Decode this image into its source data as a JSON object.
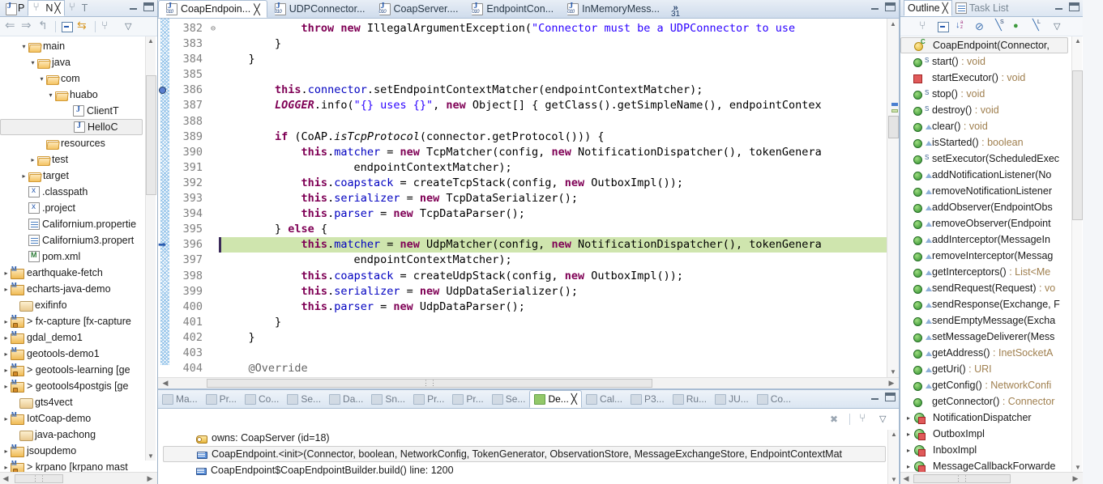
{
  "left_panel": {
    "tabs": [
      {
        "label": "P",
        "icon": "package-explorer-icon",
        "active": false
      },
      {
        "label": "N",
        "icon": "navigator-icon",
        "active": true
      },
      {
        "label": "T",
        "icon": "type-hierarchy-icon",
        "active": false
      }
    ],
    "toolbar": [
      "back-icon",
      "forward-icon",
      "up-icon",
      "collapse-all-icon",
      "link-with-editor-icon",
      "view-layout-icon",
      "view-menu-icon"
    ],
    "tree": [
      {
        "label": "main",
        "icon": "folder-icon",
        "indent": 2,
        "arrow": "open"
      },
      {
        "label": "java",
        "icon": "folder-icon",
        "indent": 3,
        "arrow": "open"
      },
      {
        "label": "com",
        "icon": "folder-icon",
        "indent": 4,
        "arrow": "open"
      },
      {
        "label": "huabo",
        "icon": "folder-icon",
        "indent": 5,
        "arrow": "open"
      },
      {
        "label": "ClientT",
        "icon": "java-file-icon",
        "indent": 7,
        "arrow": "none"
      },
      {
        "label": "HelloC",
        "icon": "java-file-icon",
        "indent": 7,
        "arrow": "none",
        "selected": true
      },
      {
        "label": "resources",
        "icon": "folder-icon",
        "indent": 4,
        "arrow": "none"
      },
      {
        "label": "test",
        "icon": "folder-icon",
        "indent": 3,
        "arrow": "closed"
      },
      {
        "label": "target",
        "icon": "folder-icon",
        "indent": 2,
        "arrow": "closed"
      },
      {
        "label": ".classpath",
        "icon": "x-file-icon",
        "indent": 2,
        "arrow": "none"
      },
      {
        "label": ".project",
        "icon": "x-file-icon",
        "indent": 2,
        "arrow": "none"
      },
      {
        "label": "Californium.propertie",
        "icon": "doc-file-icon",
        "indent": 2,
        "arrow": "none"
      },
      {
        "label": "Californium3.propert",
        "icon": "doc-file-icon",
        "indent": 2,
        "arrow": "none"
      },
      {
        "label": "pom.xml",
        "icon": "maven-file-icon",
        "indent": 2,
        "arrow": "none"
      },
      {
        "label": "earthquake-fetch",
        "icon": "maven-project-icon",
        "indent": 0,
        "arrow": "closed"
      },
      {
        "label": "echarts-java-demo",
        "icon": "maven-project-icon",
        "indent": 0,
        "arrow": "closed"
      },
      {
        "label": "exifinfo",
        "icon": "project-icon",
        "indent": 1,
        "arrow": "none"
      },
      {
        "label": "> fx-capture [fx-capture",
        "icon": "maven-project-locked-icon",
        "indent": 0,
        "arrow": "closed"
      },
      {
        "label": "gdal_demo1",
        "icon": "maven-project-icon",
        "indent": 0,
        "arrow": "closed"
      },
      {
        "label": "geotools-demo1",
        "icon": "maven-project-icon",
        "indent": 0,
        "arrow": "closed"
      },
      {
        "label": "> geotools-learning [ge",
        "icon": "maven-project-locked-icon",
        "indent": 0,
        "arrow": "closed"
      },
      {
        "label": "> geotools4postgis [ge",
        "icon": "maven-project-locked-icon",
        "indent": 0,
        "arrow": "closed"
      },
      {
        "label": "gts4vect",
        "icon": "project-icon",
        "indent": 1,
        "arrow": "none"
      },
      {
        "label": "IotCoap-demo",
        "icon": "maven-project-icon",
        "indent": 0,
        "arrow": "closed"
      },
      {
        "label": "java-pachong",
        "icon": "project-icon",
        "indent": 1,
        "arrow": "none"
      },
      {
        "label": "jsoupdemo",
        "icon": "maven-project-icon",
        "indent": 0,
        "arrow": "closed"
      },
      {
        "label": "> krpano [krpano mast",
        "icon": "maven-project-locked-icon",
        "indent": 0,
        "arrow": "closed"
      }
    ]
  },
  "editor": {
    "tabs": [
      {
        "label": "CoapEndpoin...",
        "active": true,
        "closable": true
      },
      {
        "label": "UDPConnector...",
        "active": false
      },
      {
        "label": "CoapServer....",
        "active": false
      },
      {
        "label": "EndpointCon...",
        "active": false
      },
      {
        "label": "InMemoryMess...",
        "active": false
      }
    ],
    "overflow_count": "31",
    "overflow_symbol": "»",
    "first_line": 382,
    "current_line": 396,
    "lines": [
      {
        "n": 382,
        "indent": 12,
        "parts": [
          {
            "t": "throw ",
            "c": "kw"
          },
          {
            "t": "new ",
            "c": "kw"
          },
          {
            "t": "IllegalArgumentException(",
            "c": ""
          },
          {
            "t": "\"Connector must be a UDPConnector to use",
            "c": "str"
          }
        ]
      },
      {
        "n": 383,
        "indent": 8,
        "parts": [
          {
            "t": "}",
            "c": ""
          }
        ]
      },
      {
        "n": 384,
        "indent": 4,
        "parts": [
          {
            "t": "}",
            "c": ""
          }
        ]
      },
      {
        "n": 385,
        "indent": 0,
        "parts": []
      },
      {
        "n": 386,
        "indent": 8,
        "parts": [
          {
            "t": "this",
            "c": "kw"
          },
          {
            "t": ".",
            "c": ""
          },
          {
            "t": "connector",
            "c": "fld"
          },
          {
            "t": ".setEndpointContextMatcher(endpointContextMatcher);",
            "c": ""
          }
        ]
      },
      {
        "n": 387,
        "indent": 8,
        "parts": [
          {
            "t": "LOGGER",
            "c": "stat"
          },
          {
            "t": ".info(",
            "c": ""
          },
          {
            "t": "\"{} uses {}\"",
            "c": "str"
          },
          {
            "t": ", ",
            "c": ""
          },
          {
            "t": "new ",
            "c": "kw"
          },
          {
            "t": "Object[] { getClass().getSimpleName(), endpointContex",
            "c": ""
          }
        ]
      },
      {
        "n": 388,
        "indent": 0,
        "parts": []
      },
      {
        "n": 389,
        "indent": 8,
        "parts": [
          {
            "t": "if ",
            "c": "kw"
          },
          {
            "t": "(CoAP.",
            "c": ""
          },
          {
            "t": "isTcpProtocol",
            "c": "statm"
          },
          {
            "t": "(connector.getProtocol())) {",
            "c": ""
          }
        ]
      },
      {
        "n": 390,
        "indent": 12,
        "parts": [
          {
            "t": "this",
            "c": "kw"
          },
          {
            "t": ".",
            "c": ""
          },
          {
            "t": "matcher",
            "c": "fld"
          },
          {
            "t": " = ",
            "c": ""
          },
          {
            "t": "new ",
            "c": "kw"
          },
          {
            "t": "TcpMatcher(config, ",
            "c": ""
          },
          {
            "t": "new ",
            "c": "kw"
          },
          {
            "t": "NotificationDispatcher(), tokenGenera",
            "c": ""
          }
        ]
      },
      {
        "n": 391,
        "indent": 20,
        "parts": [
          {
            "t": "endpointContextMatcher);",
            "c": ""
          }
        ]
      },
      {
        "n": 392,
        "indent": 12,
        "parts": [
          {
            "t": "this",
            "c": "kw"
          },
          {
            "t": ".",
            "c": ""
          },
          {
            "t": "coapstack",
            "c": "fld"
          },
          {
            "t": " = createTcpStack(config, ",
            "c": ""
          },
          {
            "t": "new ",
            "c": "kw"
          },
          {
            "t": "OutboxImpl());",
            "c": ""
          }
        ]
      },
      {
        "n": 393,
        "indent": 12,
        "parts": [
          {
            "t": "this",
            "c": "kw"
          },
          {
            "t": ".",
            "c": ""
          },
          {
            "t": "serializer",
            "c": "fld"
          },
          {
            "t": " = ",
            "c": ""
          },
          {
            "t": "new ",
            "c": "kw"
          },
          {
            "t": "TcpDataSerializer();",
            "c": ""
          }
        ]
      },
      {
        "n": 394,
        "indent": 12,
        "parts": [
          {
            "t": "this",
            "c": "kw"
          },
          {
            "t": ".",
            "c": ""
          },
          {
            "t": "parser",
            "c": "fld"
          },
          {
            "t": " = ",
            "c": ""
          },
          {
            "t": "new ",
            "c": "kw"
          },
          {
            "t": "TcpDataParser();",
            "c": ""
          }
        ]
      },
      {
        "n": 395,
        "indent": 8,
        "parts": [
          {
            "t": "} ",
            "c": ""
          },
          {
            "t": "else ",
            "c": "kw"
          },
          {
            "t": "{",
            "c": ""
          }
        ]
      },
      {
        "n": 396,
        "indent": 12,
        "highlight": true,
        "parts": [
          {
            "t": "this",
            "c": "kw"
          },
          {
            "t": ".",
            "c": ""
          },
          {
            "t": "matcher",
            "c": "fld"
          },
          {
            "t": " = ",
            "c": ""
          },
          {
            "t": "new ",
            "c": "kw"
          },
          {
            "t": "UdpMatcher(config, ",
            "c": ""
          },
          {
            "t": "new ",
            "c": "kw"
          },
          {
            "t": "NotificationDispatcher(), tokenGenera",
            "c": ""
          }
        ]
      },
      {
        "n": 397,
        "indent": 20,
        "parts": [
          {
            "t": "endpointContextMatcher);",
            "c": ""
          }
        ]
      },
      {
        "n": 398,
        "indent": 12,
        "parts": [
          {
            "t": "this",
            "c": "kw"
          },
          {
            "t": ".",
            "c": ""
          },
          {
            "t": "coapstack",
            "c": "fld"
          },
          {
            "t": " = createUdpStack(config, ",
            "c": ""
          },
          {
            "t": "new ",
            "c": "kw"
          },
          {
            "t": "OutboxImpl());",
            "c": ""
          }
        ]
      },
      {
        "n": 399,
        "indent": 12,
        "parts": [
          {
            "t": "this",
            "c": "kw"
          },
          {
            "t": ".",
            "c": ""
          },
          {
            "t": "serializer",
            "c": "fld"
          },
          {
            "t": " = ",
            "c": ""
          },
          {
            "t": "new ",
            "c": "kw"
          },
          {
            "t": "UdpDataSerializer();",
            "c": ""
          }
        ]
      },
      {
        "n": 400,
        "indent": 12,
        "parts": [
          {
            "t": "this",
            "c": "kw"
          },
          {
            "t": ".",
            "c": ""
          },
          {
            "t": "parser",
            "c": "fld"
          },
          {
            "t": " = ",
            "c": ""
          },
          {
            "t": "new ",
            "c": "kw"
          },
          {
            "t": "UdpDataParser();",
            "c": ""
          }
        ]
      },
      {
        "n": 401,
        "indent": 8,
        "parts": [
          {
            "t": "}",
            "c": ""
          }
        ]
      },
      {
        "n": 402,
        "indent": 4,
        "parts": [
          {
            "t": "}",
            "c": ""
          }
        ]
      },
      {
        "n": 403,
        "indent": 0,
        "parts": []
      },
      {
        "n": 404,
        "indent": 4,
        "fold": true,
        "parts": [
          {
            "t": "@Override",
            "c": "anno"
          }
        ]
      }
    ]
  },
  "bottom_panel": {
    "tabs": [
      {
        "label": "Ma...",
        "icon": "markers-icon",
        "active": false
      },
      {
        "label": "Pr...",
        "icon": "properties-icon",
        "active": false
      },
      {
        "label": "Co...",
        "icon": "console-icon",
        "active": false
      },
      {
        "label": "Se...",
        "icon": "servers-icon",
        "active": false
      },
      {
        "label": "Da...",
        "icon": "data-source-icon",
        "active": false
      },
      {
        "label": "Sn...",
        "icon": "snippets-icon",
        "active": false
      },
      {
        "label": "Pr...",
        "icon": "problems-icon",
        "active": false
      },
      {
        "label": "Pr...",
        "icon": "progress-icon",
        "active": false
      },
      {
        "label": "Se...",
        "icon": "search-icon",
        "active": false
      },
      {
        "label": "De...",
        "icon": "debug-icon",
        "active": true,
        "closable": true
      },
      {
        "label": "Cal...",
        "icon": "call-hierarchy-icon",
        "active": false
      },
      {
        "label": "P3...",
        "icon": "terminal-icon",
        "active": false
      },
      {
        "label": "Ru...",
        "icon": "terminal-icon",
        "active": false
      },
      {
        "label": "JU...",
        "icon": "junit-icon",
        "active": false
      },
      {
        "label": "Co...",
        "icon": "coverage-icon",
        "active": false
      }
    ],
    "toolbar": [
      "disconnect-icon",
      "thread-view-icon",
      "view-menu-icon"
    ],
    "stack": [
      {
        "label": "owns: CoapServer  (id=18)",
        "icon": "monitor-icon",
        "selected": false
      },
      {
        "label": "CoapEndpoint.<init>(Connector, boolean, NetworkConfig, TokenGenerator, ObservationStore, MessageExchangeStore, EndpointContextMat",
        "icon": "stack-frame-icon",
        "selected": true
      },
      {
        "label": "CoapEndpoint$CoapEndpointBuilder.build() line: 1200",
        "icon": "stack-frame-icon",
        "selected": false
      }
    ]
  },
  "right_panel": {
    "tabs": [
      {
        "label": "Outline",
        "active": true,
        "closable": true
      },
      {
        "label": "Task List",
        "active": false,
        "icon": "task-list-icon"
      }
    ],
    "toolbar": [
      "collapse-all-icon",
      "hide-fields-icon",
      "sort-icon",
      "hide-static-icon",
      "hide-nonpublic-icon",
      "hide-local-icon",
      "filter-icon",
      "view-menu-icon"
    ],
    "items": [
      {
        "label": "CoapEndpoint(Connector,",
        "icon": "constructor-icon",
        "mod": "",
        "selected": true
      },
      {
        "label": "start() : void",
        "icon": "method-public-icon",
        "mod": "static-sync",
        "type": ""
      },
      {
        "label": "startExecutor() : void",
        "icon": "method-private-icon",
        "mod": "",
        "type": ""
      },
      {
        "label": "stop() : void",
        "icon": "method-public-icon",
        "mod": "static-sync",
        "type": ""
      },
      {
        "label": "destroy() : void",
        "icon": "method-public-icon",
        "mod": "static-sync",
        "type": ""
      },
      {
        "label": "clear() : void",
        "icon": "method-public-icon",
        "mod": "tri",
        "type": ""
      },
      {
        "label": "isStarted() : boolean",
        "icon": "method-public-icon",
        "mod": "tri",
        "type": ""
      },
      {
        "label": "setExecutor(ScheduledExec",
        "icon": "method-public-icon",
        "mod": "static-sync",
        "type": ""
      },
      {
        "label": "addNotificationListener(No",
        "icon": "method-public-icon",
        "mod": "tri",
        "type": ""
      },
      {
        "label": "removeNotificationListener",
        "icon": "method-public-icon",
        "mod": "tri",
        "type": ""
      },
      {
        "label": "addObserver(EndpointObs",
        "icon": "method-public-icon",
        "mod": "tri",
        "type": ""
      },
      {
        "label": "removeObserver(Endpoint",
        "icon": "method-public-icon",
        "mod": "tri",
        "type": ""
      },
      {
        "label": "addInterceptor(MessageIn",
        "icon": "method-public-icon",
        "mod": "tri",
        "type": ""
      },
      {
        "label": "removeInterceptor(Messag",
        "icon": "method-public-icon",
        "mod": "tri",
        "type": ""
      },
      {
        "label": "getInterceptors() : List<Me",
        "icon": "method-public-icon",
        "mod": "tri",
        "type": ""
      },
      {
        "label": "sendRequest(Request) : vo",
        "icon": "method-public-icon",
        "mod": "tri",
        "type": ""
      },
      {
        "label": "sendResponse(Exchange, F",
        "icon": "method-public-icon",
        "mod": "tri",
        "type": ""
      },
      {
        "label": "sendEmptyMessage(Excha",
        "icon": "method-public-icon",
        "mod": "tri",
        "type": ""
      },
      {
        "label": "setMessageDeliverer(Mess",
        "icon": "method-public-icon",
        "mod": "tri",
        "type": ""
      },
      {
        "label": "getAddress() : InetSocketA",
        "icon": "method-public-icon",
        "mod": "tri",
        "type": ""
      },
      {
        "label": "getUri() : URI",
        "icon": "method-public-icon",
        "mod": "tri",
        "type": ""
      },
      {
        "label": "getConfig() : NetworkConfi",
        "icon": "method-public-icon",
        "mod": "tri",
        "type": ""
      },
      {
        "label": "getConnector() : Connector",
        "icon": "method-public-icon",
        "mod": "",
        "type": ""
      },
      {
        "label": "NotificationDispatcher",
        "icon": "inner-class-icon",
        "arrow": "closed"
      },
      {
        "label": "OutboxImpl",
        "icon": "inner-class-icon",
        "arrow": "closed"
      },
      {
        "label": "InboxImpl",
        "icon": "inner-class-icon",
        "arrow": "closed"
      },
      {
        "label": "MessageCallbackForwarde",
        "icon": "inner-class-icon",
        "arrow": "closed"
      }
    ]
  }
}
